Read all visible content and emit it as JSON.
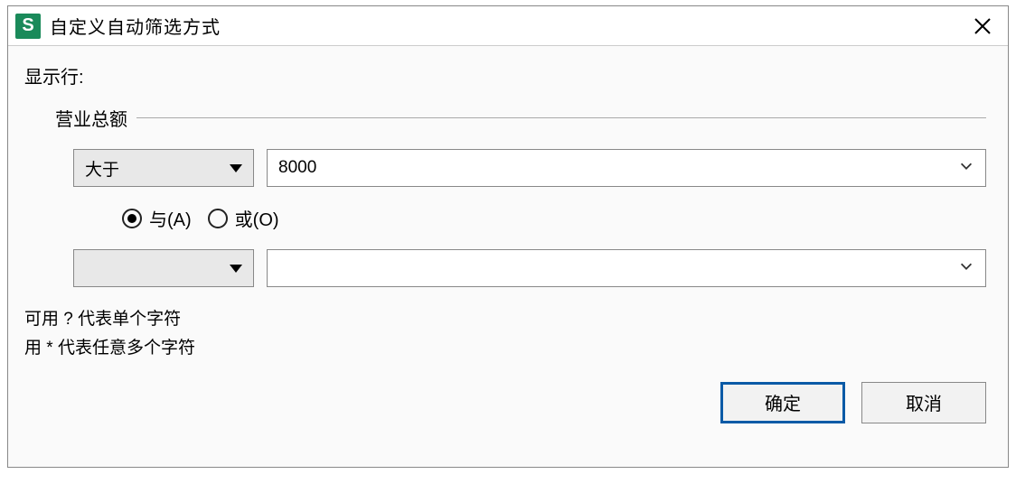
{
  "dialog": {
    "app_icon_letter": "S",
    "title": "自定义自动筛选方式",
    "show_rows_label": "显示行:",
    "field_label": "营业总额",
    "criteria": [
      {
        "operator": "大于",
        "value": "8000"
      },
      {
        "operator": "",
        "value": ""
      }
    ],
    "logic": {
      "and_label": "与(A)",
      "or_label": "或(O)",
      "selected": "and"
    },
    "hints": {
      "line1": "可用 ? 代表单个字符",
      "line2": "用 * 代表任意多个字符"
    },
    "buttons": {
      "ok": "确定",
      "cancel": "取消"
    }
  }
}
